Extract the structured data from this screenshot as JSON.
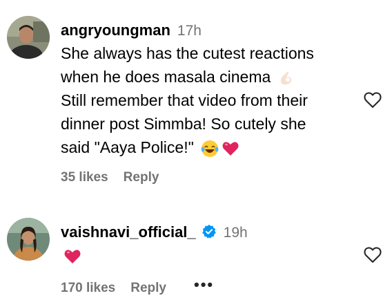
{
  "comments": [
    {
      "username": "angryoungman",
      "time": "17h",
      "lines": [
        "She always has the cutest reactions",
        "when he does masala cinema",
        "Still remember that video from their",
        "dinner post Simmba! So cutely she",
        "said \"Aaya Police!\""
      ],
      "emojis": [
        "ok-hand-emoji",
        "laughing-tears-emoji",
        "red-heart-emoji"
      ],
      "likes": "35 likes",
      "reply": "Reply"
    },
    {
      "username": "vaishnavi_official_",
      "time": "19h",
      "verified": true,
      "emojis": [
        "red-heart-emoji"
      ],
      "likes": "170 likes",
      "reply": "Reply",
      "more": "•••"
    }
  ],
  "colors": {
    "text": "#000000",
    "secondary": "#737373",
    "verified_blue": "#0095f6",
    "heart_red": "#e0245e"
  }
}
